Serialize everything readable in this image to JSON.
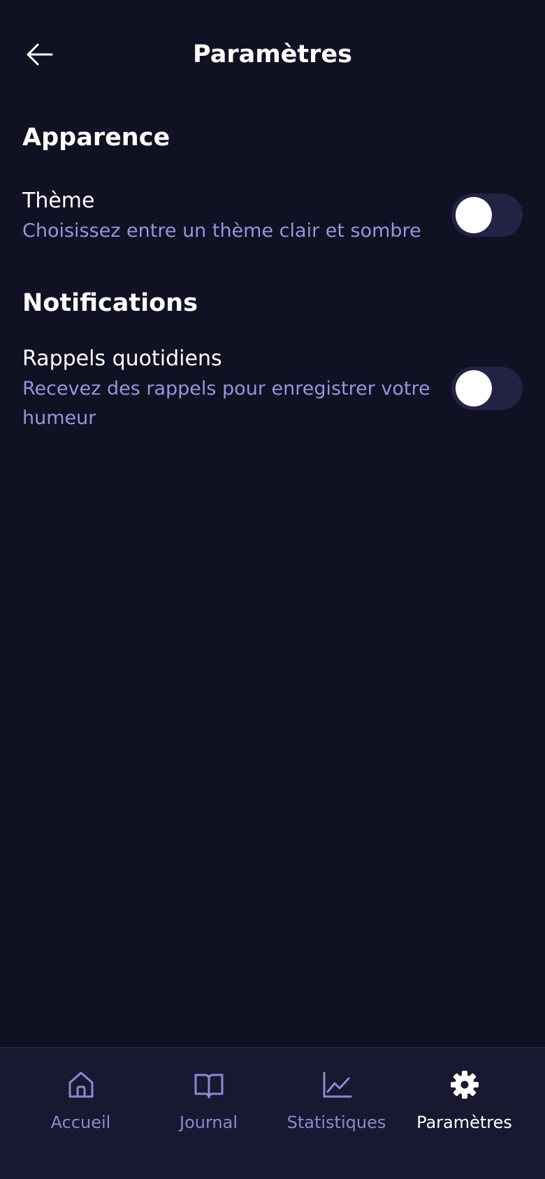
{
  "header": {
    "title": "Paramètres",
    "back_icon": "arrow-left-icon"
  },
  "sections": {
    "appearance": {
      "title": "Apparence",
      "theme": {
        "label": "Thème",
        "description": "Choisissez entre un thème clair et sombre",
        "enabled": false
      }
    },
    "notifications": {
      "title": "Notifications",
      "daily_reminders": {
        "label": "Rappels quotidiens",
        "description": "Recevez des rappels pour enregistrer votre humeur",
        "enabled": false
      }
    }
  },
  "bottom_nav": {
    "items": [
      {
        "label": "Accueil",
        "icon": "home-icon",
        "active": false
      },
      {
        "label": "Journal",
        "icon": "book-icon",
        "active": false
      },
      {
        "label": "Statistiques",
        "icon": "chart-icon",
        "active": false
      },
      {
        "label": "Paramètres",
        "icon": "gear-icon",
        "active": true
      }
    ]
  },
  "colors": {
    "background": "#101123",
    "accent_text": "#9a93dc",
    "nav_background": "#181831",
    "toggle_track": "#232346"
  }
}
